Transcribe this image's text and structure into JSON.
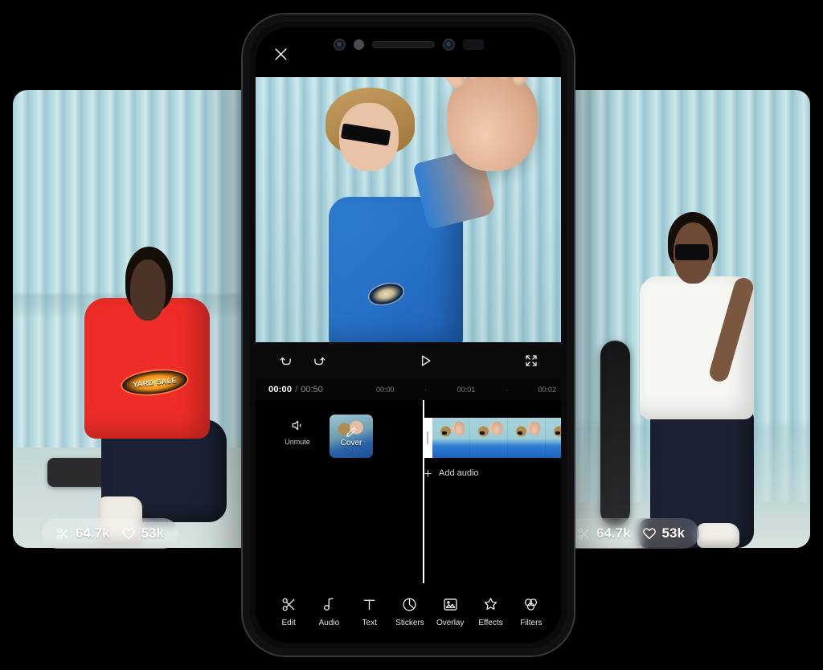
{
  "app": {
    "close_label": "Close"
  },
  "player": {
    "undo_label": "Undo",
    "redo_label": "Redo",
    "play_label": "Play",
    "fullscreen_label": "Fullscreen"
  },
  "timeline": {
    "current_time": "00:00",
    "separator": "/",
    "total_time": "00:50",
    "ruler": [
      "00:00",
      "·",
      "00:01",
      "·",
      "00:02"
    ],
    "unmute_label": "Unmute",
    "cover_label": "Cover",
    "add_audio_label": "Add audio",
    "add_clip_label": "+"
  },
  "toolbar": {
    "items": [
      {
        "label": "Edit",
        "icon": "scissors-icon"
      },
      {
        "label": "Audio",
        "icon": "music-note-icon"
      },
      {
        "label": "Text",
        "icon": "text-icon"
      },
      {
        "label": "Stickers",
        "icon": "sticker-icon"
      },
      {
        "label": "Overlay",
        "icon": "overlay-icon"
      },
      {
        "label": "Effects",
        "icon": "sparkle-icon"
      },
      {
        "label": "Filters",
        "icon": "filters-icon"
      }
    ]
  },
  "stats": {
    "left": {
      "clips": "64.7k",
      "likes": "53k"
    },
    "right": {
      "clips": "64.7k",
      "likes": "53k"
    }
  },
  "media": {
    "left_photo_alt": "Skater in red YARD SALE tee sitting on skateboard",
    "left_tee_text": "YARD SALE",
    "center_video_alt": "Skater in blue tee reaching hand toward camera",
    "right_photo_alt": "Skater in white tee holding skateboard"
  },
  "colors": {
    "phone_body": "#0b0b0c",
    "screen_bg": "#000000",
    "accent_white": "#ffffff",
    "wall_blue": "#a9d2da",
    "tee_red": "#ef2d28",
    "tee_blue": "#2f7fd4"
  }
}
